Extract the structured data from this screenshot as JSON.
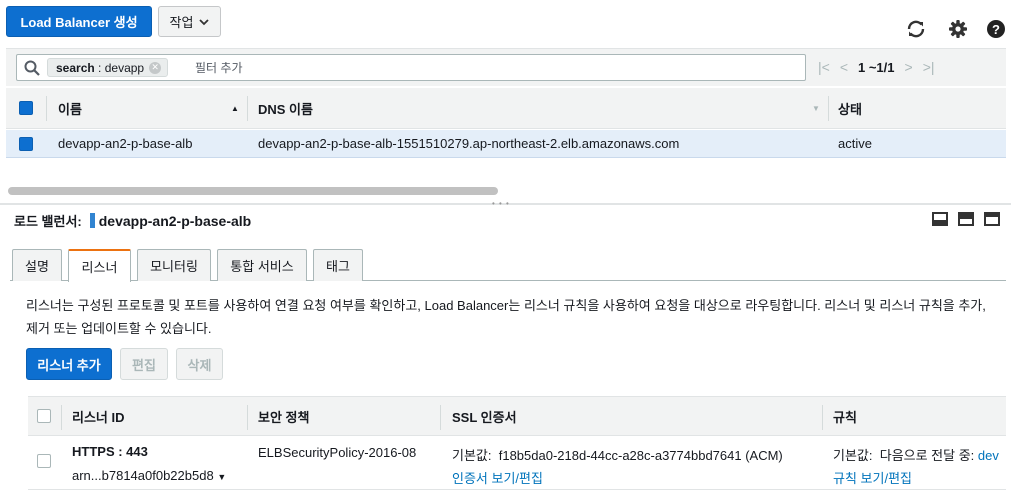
{
  "toolbar": {
    "create_lb_label": "Load Balancer 생성",
    "actions_label": "작업",
    "icons": [
      "refresh-icon",
      "gear-icon",
      "help-icon"
    ]
  },
  "filter": {
    "chip_key": "search",
    "chip_value": "devapp",
    "placeholder": "필터 추가",
    "pagination": "1 ~1/1"
  },
  "lb_table": {
    "columns": [
      "이름",
      "DNS 이름",
      "상태"
    ],
    "rows": [
      {
        "name": "devapp-an2-p-base-alb",
        "dns": "devapp-an2-p-base-alb-1551510279.ap-northeast-2.elb.amazonaws.com",
        "state": "active",
        "selected": true
      }
    ]
  },
  "detail": {
    "label": "로드 밸런서:",
    "name": "devapp-an2-p-base-alb",
    "tabs": [
      "설명",
      "리스너",
      "모니터링",
      "통합 서비스",
      "태그"
    ],
    "active_tab": "리스너",
    "description": "리스너는 구성된 프로토콜 및 포트를 사용하여 연결 요청 여부를 확인하고, Load Balancer는 리스너 규칙을 사용하여 요청을 대상으로 라우팅합니다. 리스너 및 리스너 규칙을 추가, 제거 또는 업데이트할 수 있습니다.",
    "buttons": {
      "add": "리스너 추가",
      "edit": "편집",
      "delete": "삭제"
    }
  },
  "listener_table": {
    "columns": [
      "리스너 ID",
      "보안 정책",
      "SSL 인증서",
      "규칙"
    ],
    "rows": [
      {
        "id": "HTTPS : 443",
        "arn": "arn...b7814a0f0b22b5d8",
        "policy": "ELBSecurityPolicy-2016-08",
        "ssl_label": "기본값:",
        "ssl_value": "f18b5da0-218d-44cc-a28c-a3774bbd7641 (ACM)",
        "ssl_link": "인증서 보기/편집",
        "rule_label": "기본값:",
        "rule_value": "다음으로 전달 중:",
        "rule_target": "dev",
        "rule_link": "규칙 보기/편집"
      }
    ]
  },
  "colors": {
    "primary": "#0d6fd0",
    "selected_row": "#e4eef9",
    "active_tab_accent": "#ec7211",
    "link": "#0073bb"
  }
}
